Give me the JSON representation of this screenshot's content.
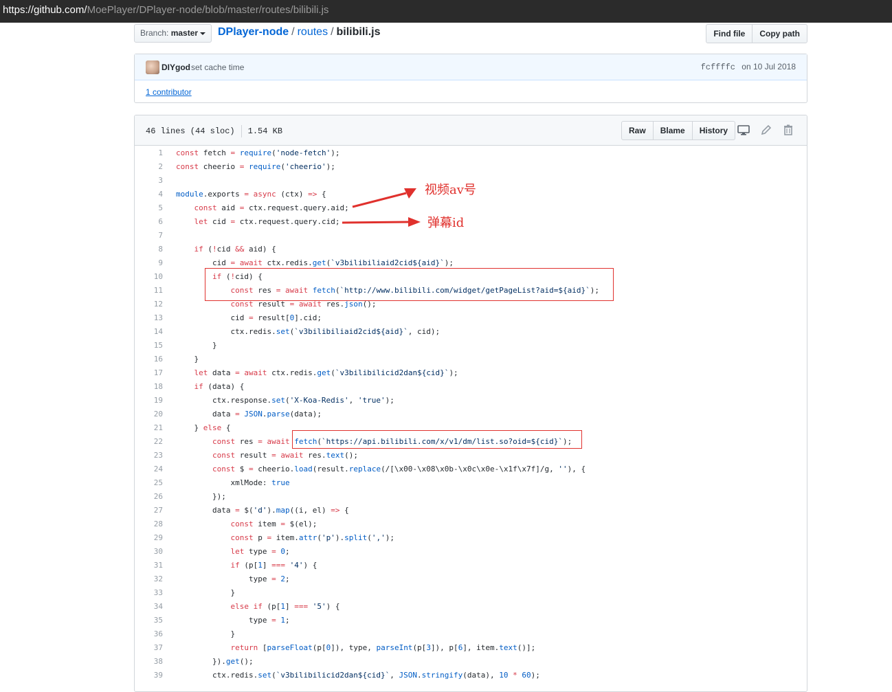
{
  "browser": {
    "url_host": "https://github.com/",
    "url_path": "MoePlayer/DPlayer-node/blob/master/routes/bilibili.js"
  },
  "path_bar": {
    "branch_label": "Branch:",
    "branch_value": "master",
    "repo": "DPlayer-node",
    "sep1": "/",
    "dir": "routes",
    "sep2": "/",
    "file": "bilibili.js",
    "find_file": "Find file",
    "copy_path": "Copy path"
  },
  "commit": {
    "author": "DIYgod",
    "message": "set cache time",
    "sha": "fcffffc",
    "date": "on 10 Jul 2018",
    "contributors": "1 contributor"
  },
  "file": {
    "lines_info": "46 lines (44 sloc)",
    "size": "1.54 KB",
    "raw": "Raw",
    "blame": "Blame",
    "history": "History",
    "icons": [
      "desktop-icon",
      "pencil-icon",
      "trash-icon"
    ]
  },
  "annotations": {
    "aid_note": "视频av号",
    "cid_note": "弹幕id",
    "color": "#e0312d"
  },
  "code_lines": [
    [
      "1",
      "const fetch = require('node-fetch');"
    ],
    [
      "2",
      "const cheerio = require('cheerio');"
    ],
    [
      "3",
      ""
    ],
    [
      "4",
      "module.exports = async (ctx) => {"
    ],
    [
      "5",
      "    const aid = ctx.request.query.aid;"
    ],
    [
      "6",
      "    let cid = ctx.request.query.cid;"
    ],
    [
      "7",
      ""
    ],
    [
      "8",
      "    if (!cid && aid) {"
    ],
    [
      "9",
      "        cid = await ctx.redis.get(`v3bilibiliaid2cid${aid}`);"
    ],
    [
      "10",
      "        if (!cid) {"
    ],
    [
      "11",
      "            const res = await fetch(`http://www.bilibili.com/widget/getPageList?aid=${aid}`);"
    ],
    [
      "12",
      "            const result = await res.json();"
    ],
    [
      "13",
      "            cid = result[0].cid;"
    ],
    [
      "14",
      "            ctx.redis.set(`v3bilibiliaid2cid${aid}`, cid);"
    ],
    [
      "15",
      "        }"
    ],
    [
      "16",
      "    }"
    ],
    [
      "17",
      "    let data = await ctx.redis.get(`v3bilibilicid2dan${cid}`);"
    ],
    [
      "18",
      "    if (data) {"
    ],
    [
      "19",
      "        ctx.response.set('X-Koa-Redis', 'true');"
    ],
    [
      "20",
      "        data = JSON.parse(data);"
    ],
    [
      "21",
      "    } else {"
    ],
    [
      "22",
      "        const res = await fetch(`https://api.bilibili.com/x/v1/dm/list.so?oid=${cid}`);"
    ],
    [
      "23",
      "        const result = await res.text();"
    ],
    [
      "24",
      "        const $ = cheerio.load(result.replace(/[\\x00-\\x08\\x0b-\\x0c\\x0e-\\x1f\\x7f]/g, ''), {"
    ],
    [
      "25",
      "            xmlMode: true"
    ],
    [
      "26",
      "        });"
    ],
    [
      "27",
      "        data = $('d').map((i, el) => {"
    ],
    [
      "28",
      "            const item = $(el);"
    ],
    [
      "29",
      "            const p = item.attr('p').split(',');"
    ],
    [
      "30",
      "            let type = 0;"
    ],
    [
      "31",
      "            if (p[1] === '4') {"
    ],
    [
      "32",
      "                type = 2;"
    ],
    [
      "33",
      "            }"
    ],
    [
      "34",
      "            else if (p[1] === '5') {"
    ],
    [
      "35",
      "                type = 1;"
    ],
    [
      "36",
      "            }"
    ],
    [
      "37",
      "            return [parseFloat(p[0]), type, parseInt(p[3]), p[6], item.text()];"
    ],
    [
      "38",
      "        }).get();"
    ],
    [
      "39",
      "        ctx.redis.set(`v3bilibilicid2dan${cid}`, JSON.stringify(data), 10 * 60);"
    ]
  ]
}
